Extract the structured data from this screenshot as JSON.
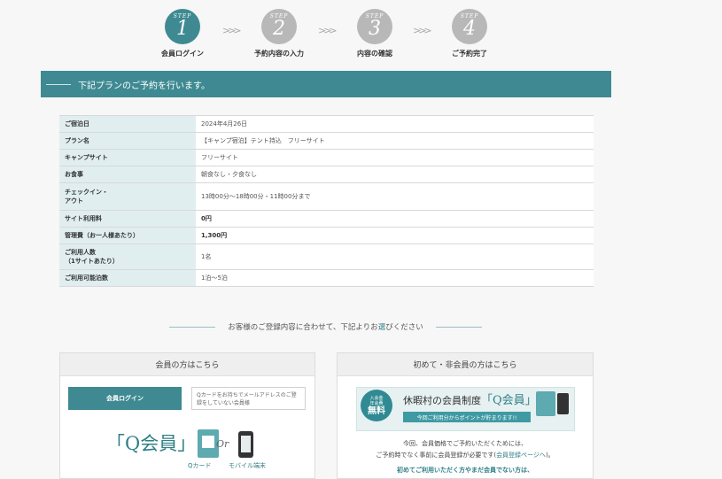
{
  "steps": [
    {
      "word": "STEP",
      "num": "1",
      "label": "会員ログイン",
      "active": true
    },
    {
      "word": "STEP",
      "num": "2",
      "label": "予約内容の入力",
      "active": false
    },
    {
      "word": "STEP",
      "num": "3",
      "label": "内容の確認",
      "active": false
    },
    {
      "word": "STEP",
      "num": "4",
      "label": "ご予約完了",
      "active": false
    }
  ],
  "banner": {
    "text": "下記プランのご予約を行います。"
  },
  "plan": {
    "rows": [
      {
        "label": "ご宿泊日",
        "value": "2024年4月26日"
      },
      {
        "label": "プラン名",
        "value": "【キャンプ宿泊】テント持込　フリーサイト"
      },
      {
        "label": "キャンプサイト",
        "value": "フリーサイト"
      },
      {
        "label": "お食事",
        "value": "朝食なし・夕食なし"
      },
      {
        "label_line1": "チェックイン・",
        "label_line2": "アウト",
        "value": "13時00分～18時00分・11時00分まで"
      },
      {
        "label": "サイト利用料",
        "value": "0円"
      },
      {
        "label": "管理費（お一人様あたり）",
        "value": "1,300円"
      },
      {
        "label_line1": "ご利用人数",
        "label_line2": "（1サイトあたり）",
        "value": "1名"
      },
      {
        "label": "ご利用可能泊数",
        "value": "1泊～5泊"
      }
    ]
  },
  "select_heading": {
    "before": "お客様のご登録内容に合わせて、下記よりお",
    "highlight": "選",
    "after": "びください"
  },
  "member_card": {
    "title": "会員の方はこちら",
    "login_button": "会員ログイン",
    "note": "Qカードをお持ちでメールアドレスのご登録をしていない会員様",
    "qmember": "「Q会員」",
    "or": "Or",
    "qcard_caption": "Qカード",
    "mobile_caption": "モバイル端末"
  },
  "nonmember_card": {
    "title": "初めて・非会員の方はこちら",
    "badge_top1": "入会金",
    "badge_top2": "年会費",
    "badge_big": "無料",
    "promo_title": "休暇村の会員制度",
    "promo_q": "「Q会員」",
    "promo_sub": "今回ご利用分からポイントが貯まります!!",
    "text_line1": "今回、会員価格でご予約いただくためには、",
    "text_line2_a": "ご予約時でなく事前に会員登録が必要です(",
    "text_line2_link": "会員登録ページへ",
    "text_line2_b": ")。",
    "text_line3": "初めてご利用いただく方やまだ会員でない方は、"
  },
  "colors": {
    "accent": "#3f8a92",
    "step_inactive": "#b8b8b8",
    "table_header": "#e1eef0"
  }
}
